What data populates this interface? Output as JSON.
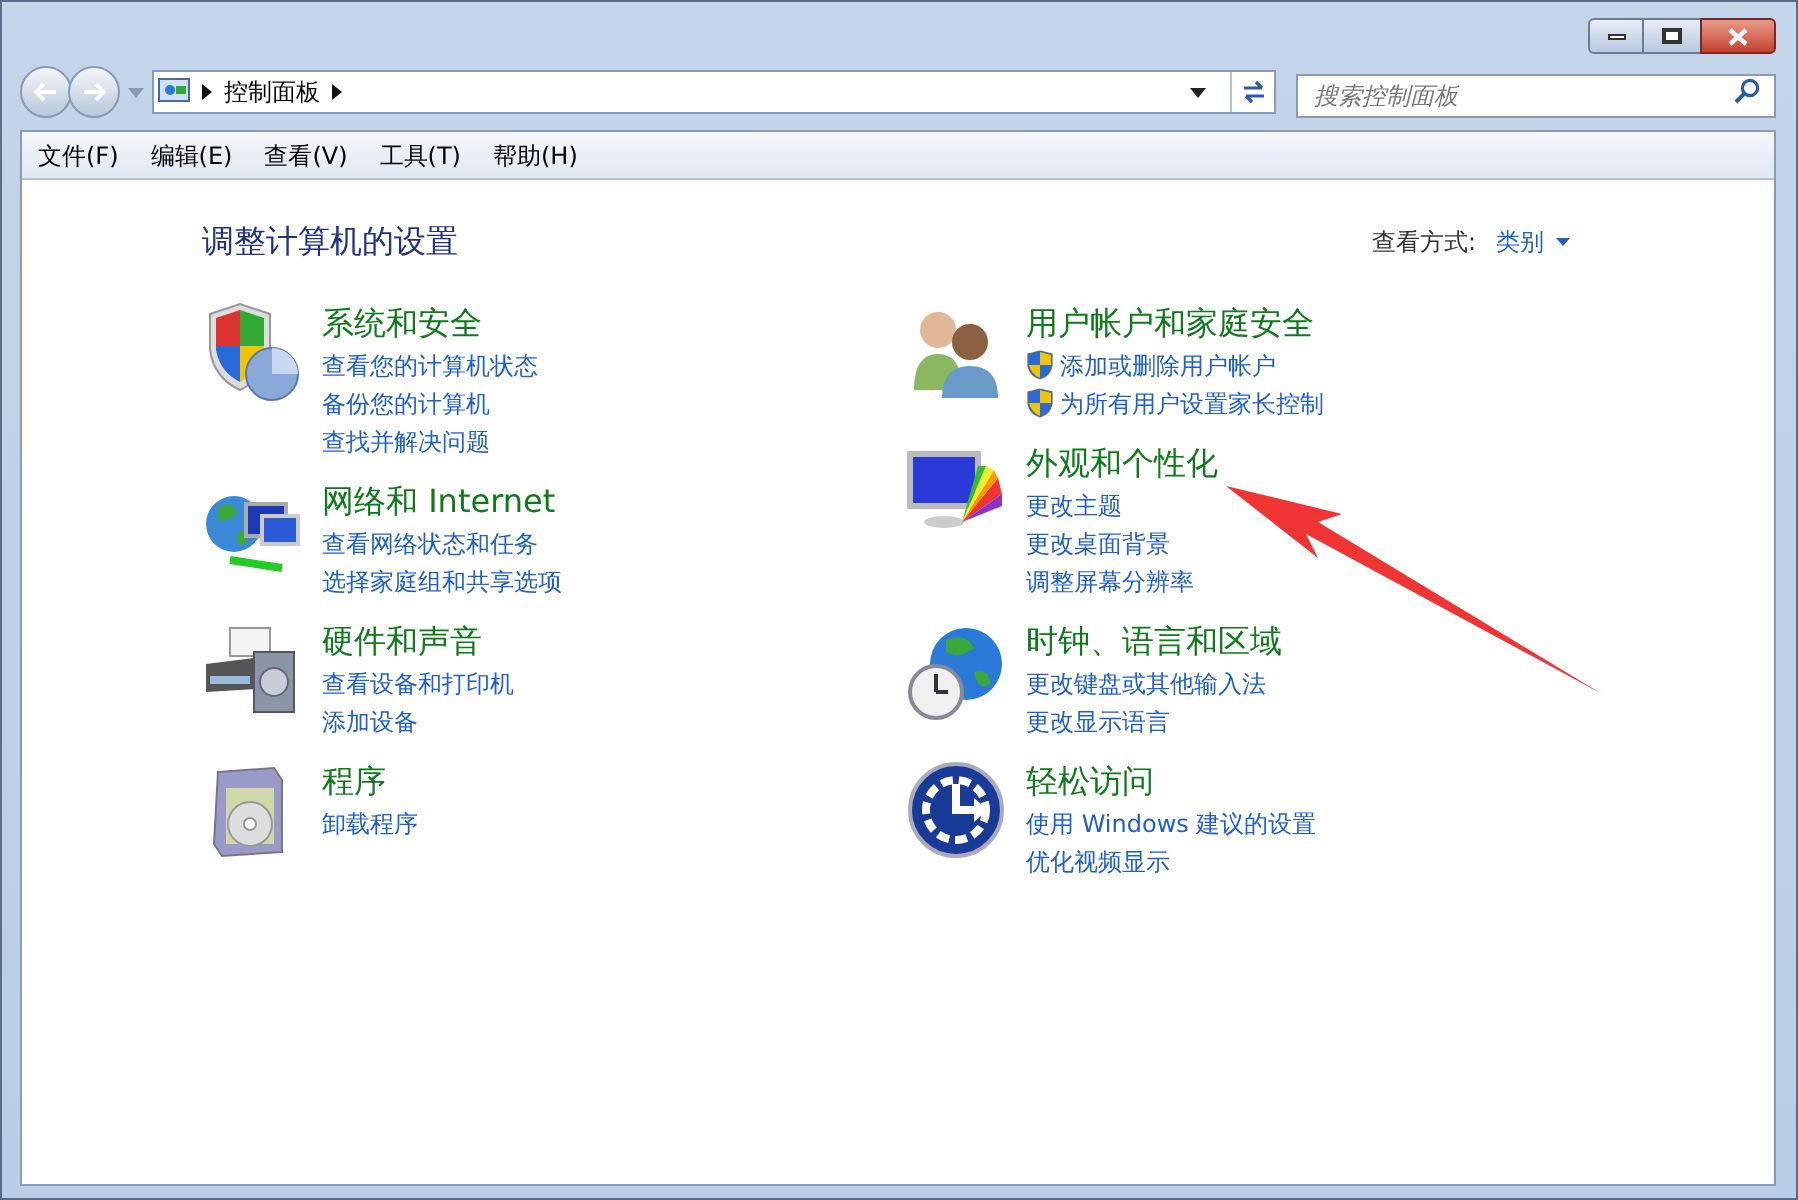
{
  "address_bar": {
    "breadcrumb": "控制面板"
  },
  "search": {
    "placeholder": "搜索控制面板"
  },
  "menu": [
    "文件(F)",
    "编辑(E)",
    "查看(V)",
    "工具(T)",
    "帮助(H)"
  ],
  "heading": "调整计算机的设置",
  "view_by": {
    "label": "查看方式:",
    "value": "类别"
  },
  "columns": [
    {
      "categories": [
        {
          "kind": "security",
          "title": "系统和安全",
          "links": [
            {
              "kind": "plain",
              "text": "查看您的计算机状态"
            },
            {
              "kind": "plain",
              "text": "备份您的计算机"
            },
            {
              "kind": "plain",
              "text": "查找并解决问题"
            }
          ]
        },
        {
          "kind": "network",
          "title": "网络和 Internet",
          "links": [
            {
              "kind": "plain",
              "text": "查看网络状态和任务"
            },
            {
              "kind": "plain",
              "text": "选择家庭组和共享选项"
            }
          ]
        },
        {
          "kind": "hardware",
          "title": "硬件和声音",
          "links": [
            {
              "kind": "plain",
              "text": "查看设备和打印机"
            },
            {
              "kind": "plain",
              "text": "添加设备"
            }
          ]
        },
        {
          "kind": "programs",
          "title": "程序",
          "links": [
            {
              "kind": "plain",
              "text": "卸载程序"
            }
          ]
        }
      ]
    },
    {
      "categories": [
        {
          "kind": "users",
          "title": "用户帐户和家庭安全",
          "links": [
            {
              "kind": "shield",
              "text": "添加或删除用户帐户"
            },
            {
              "kind": "shield",
              "text": "为所有用户设置家长控制"
            }
          ]
        },
        {
          "kind": "appearance",
          "title": "外观和个性化",
          "links": [
            {
              "kind": "plain",
              "text": "更改主题"
            },
            {
              "kind": "plain",
              "text": "更改桌面背景"
            },
            {
              "kind": "plain",
              "text": "调整屏幕分辨率"
            }
          ]
        },
        {
          "kind": "clock",
          "title": "时钟、语言和区域",
          "links": [
            {
              "kind": "plain",
              "text": "更改键盘或其他输入法"
            },
            {
              "kind": "plain",
              "text": "更改显示语言"
            }
          ]
        },
        {
          "kind": "access",
          "title": "轻松访问",
          "links": [
            {
              "kind": "plain",
              "text": "使用 Windows 建议的设置"
            },
            {
              "kind": "plain",
              "text": "优化视频显示"
            }
          ]
        }
      ]
    }
  ]
}
